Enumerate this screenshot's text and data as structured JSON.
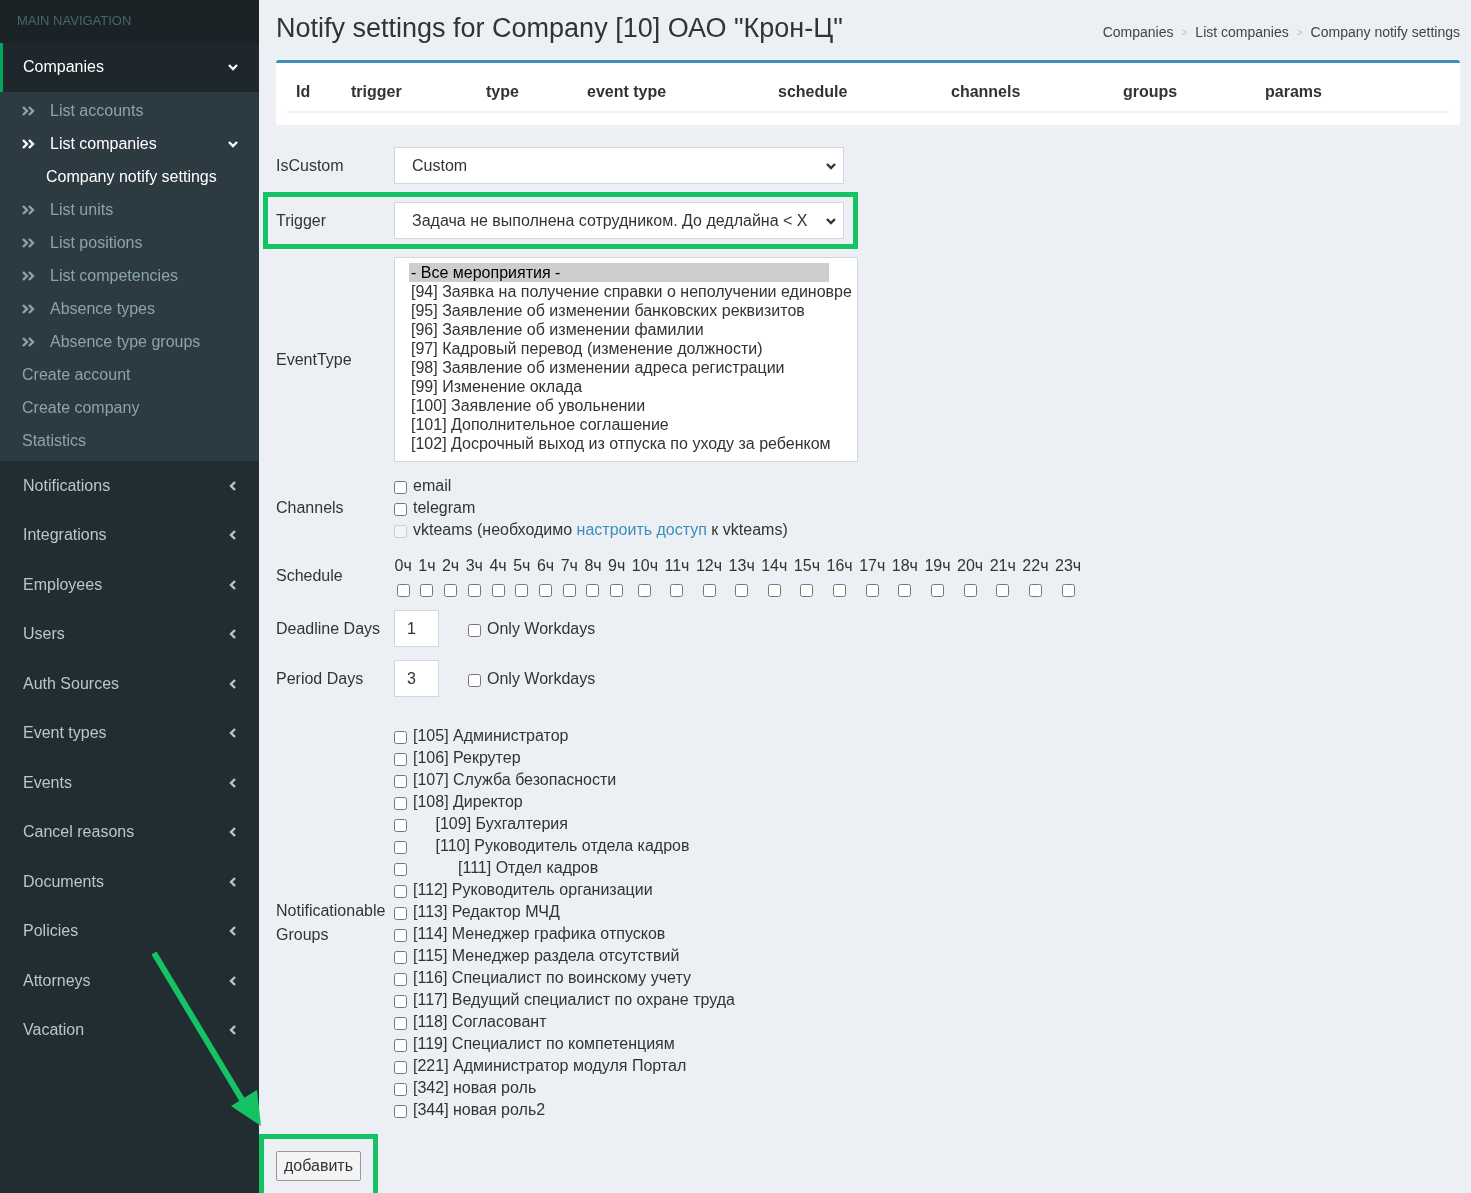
{
  "sidebar": {
    "header": "MAIN NAVIGATION",
    "items": [
      {
        "label": "Companies",
        "expanded": true,
        "selected": true,
        "children": [
          {
            "label": "List accounts",
            "kind": "arrow",
            "selected": false
          },
          {
            "label": "List companies",
            "kind": "arrow",
            "selected": true,
            "expanded": true,
            "children": [
              {
                "label": "Company notify settings",
                "kind": "plain",
                "selected": true
              }
            ]
          },
          {
            "label": "List units",
            "kind": "arrow",
            "selected": false
          },
          {
            "label": "List positions",
            "kind": "arrow",
            "selected": false
          },
          {
            "label": "List competencies",
            "kind": "arrow",
            "selected": false
          },
          {
            "label": "Absence types",
            "kind": "arrow",
            "selected": false
          },
          {
            "label": "Absence type groups",
            "kind": "arrow",
            "selected": false
          },
          {
            "label": "Create account",
            "kind": "plain",
            "selected": false
          },
          {
            "label": "Create company",
            "kind": "plain",
            "selected": false
          },
          {
            "label": "Statistics",
            "kind": "plain",
            "selected": false
          }
        ]
      },
      {
        "label": "Notifications",
        "expanded": false,
        "selected": false
      },
      {
        "label": "Integrations",
        "expanded": false,
        "selected": false
      },
      {
        "label": "Employees",
        "expanded": false,
        "selected": false
      },
      {
        "label": "Users",
        "expanded": false,
        "selected": false
      },
      {
        "label": "Auth Sources",
        "expanded": false,
        "selected": false
      },
      {
        "label": "Event types",
        "expanded": false,
        "selected": false
      },
      {
        "label": "Events",
        "expanded": false,
        "selected": false
      },
      {
        "label": "Cancel reasons",
        "expanded": false,
        "selected": false
      },
      {
        "label": "Documents",
        "expanded": false,
        "selected": false
      },
      {
        "label": "Policies",
        "expanded": false,
        "selected": false
      },
      {
        "label": "Attorneys",
        "expanded": false,
        "selected": false
      },
      {
        "label": "Vacation",
        "expanded": false,
        "selected": false
      }
    ]
  },
  "page_title": "Notify settings for Company [10] ОАО \"Крон-Ц\"",
  "breadcrumb": [
    "Companies",
    "List companies",
    "Company notify settings"
  ],
  "breadcrumb_separator": ">",
  "table": {
    "columns": [
      "Id",
      "trigger",
      "type",
      "event type",
      "schedule",
      "channels",
      "groups",
      "params"
    ]
  },
  "form": {
    "is_custom": {
      "label": "IsCustom",
      "value": "Custom"
    },
    "trigger": {
      "label": "Trigger",
      "value": "Задача не выполнена сотрудником. До дедлайна < X",
      "highlighted": true
    },
    "event_type": {
      "label": "EventType",
      "options": [
        {
          "label": "- Все мероприятия -",
          "selected": true
        },
        {
          "label": "[94] Заявка на получение справки о неполучении единовре",
          "selected": false
        },
        {
          "label": "[95] Заявление об изменении банковских реквизитов",
          "selected": false
        },
        {
          "label": "[96] Заявление об изменении фамилии",
          "selected": false
        },
        {
          "label": "[97] Кадровый перевод (изменение должности)",
          "selected": false
        },
        {
          "label": "[98] Заявление об изменении адреса регистрации",
          "selected": false
        },
        {
          "label": "[99] Изменение оклада",
          "selected": false
        },
        {
          "label": "[100] Заявление об увольнении",
          "selected": false
        },
        {
          "label": "[101] Дополнительное соглашение",
          "selected": false
        },
        {
          "label": "[102] Досрочный выход из отпуска по уходу за ребенком",
          "selected": false
        }
      ]
    },
    "channels": {
      "label": "Channels",
      "items": [
        {
          "label": "email",
          "checked": false,
          "disabled": false
        },
        {
          "label": "telegram",
          "checked": false,
          "disabled": false
        },
        {
          "label": "vkteams (необходимо",
          "link": "настроить доступ",
          "label_after": "к vkteams)",
          "checked": false,
          "disabled": true
        }
      ]
    },
    "schedule": {
      "label": "Schedule",
      "hours": [
        {
          "label": "0ч",
          "checked": false
        },
        {
          "label": "1ч",
          "checked": false
        },
        {
          "label": "2ч",
          "checked": false
        },
        {
          "label": "3ч",
          "checked": false
        },
        {
          "label": "4ч",
          "checked": false
        },
        {
          "label": "5ч",
          "checked": false
        },
        {
          "label": "6ч",
          "checked": false
        },
        {
          "label": "7ч",
          "checked": false
        },
        {
          "label": "8ч",
          "checked": false
        },
        {
          "label": "9ч",
          "checked": false
        },
        {
          "label": "10ч",
          "checked": false
        },
        {
          "label": "11ч",
          "checked": false
        },
        {
          "label": "12ч",
          "checked": false
        },
        {
          "label": "13ч",
          "checked": false
        },
        {
          "label": "14ч",
          "checked": false
        },
        {
          "label": "15ч",
          "checked": false
        },
        {
          "label": "16ч",
          "checked": false
        },
        {
          "label": "17ч",
          "checked": false
        },
        {
          "label": "18ч",
          "checked": false
        },
        {
          "label": "19ч",
          "checked": false
        },
        {
          "label": "20ч",
          "checked": false
        },
        {
          "label": "21ч",
          "checked": false
        },
        {
          "label": "22ч",
          "checked": false
        },
        {
          "label": "23ч",
          "checked": false
        }
      ]
    },
    "deadline_days": {
      "label": "Deadline Days",
      "value": "1",
      "workdays_label": "Only Workdays",
      "workdays_checked": false
    },
    "period_days": {
      "label": "Period Days",
      "value": "3",
      "workdays_label": "Only Workdays",
      "workdays_checked": false
    },
    "groups": {
      "label": "Notificationable Groups",
      "items": [
        {
          "label": "[105] Администратор",
          "checked": false
        },
        {
          "label": "[106] Рекрутер",
          "checked": false
        },
        {
          "label": "[107] Служба безопасности",
          "checked": false
        },
        {
          "label": "[108] Директор",
          "checked": false,
          "children": [
            {
              "label": "[109] Бухгалтерия",
              "checked": false
            },
            {
              "label": "[110] Руководитель отдела кадров",
              "checked": false,
              "children": [
                {
                  "label": "[111] Отдел кадров",
                  "checked": false
                }
              ]
            }
          ]
        },
        {
          "label": "[112] Руководитель организации",
          "checked": false
        },
        {
          "label": "[113] Редактор МЧД",
          "checked": false
        },
        {
          "label": "[114] Менеджер графика отпусков",
          "checked": false
        },
        {
          "label": "[115] Менеджер раздела отсутствий",
          "checked": false
        },
        {
          "label": "[116] Специалист по воинскому учету",
          "checked": false
        },
        {
          "label": "[117] Ведущий специалист по охране труда",
          "checked": false
        },
        {
          "label": "[118] Согласовант",
          "checked": false
        },
        {
          "label": "[119] Специалист по компетенциям",
          "checked": false
        },
        {
          "label": "[221] Администратор модуля Портал",
          "checked": false
        },
        {
          "label": "[342] новая роль",
          "checked": false
        },
        {
          "label": "[344] новая роль2",
          "checked": false
        }
      ]
    },
    "submit": {
      "label": "добавить",
      "highlighted": true
    },
    "pointer_arrow": true
  }
}
